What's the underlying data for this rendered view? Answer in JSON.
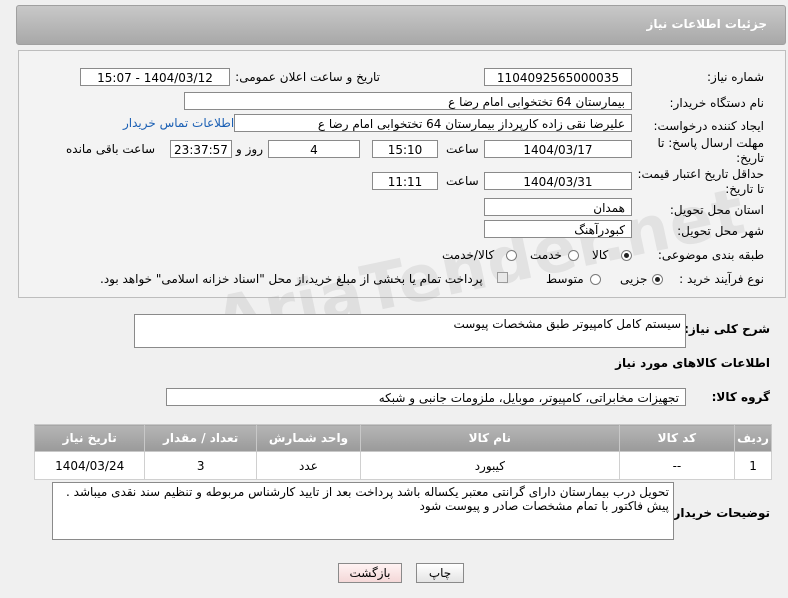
{
  "header": {
    "title": "جزئیات اطلاعات نیاز"
  },
  "form": {
    "need_number_label": "شماره نیاز:",
    "need_number": "1104092565000035",
    "announce_label": "تاریخ و ساعت اعلان عمومی:",
    "announce_value": "1404/03/12 - 15:07",
    "buyer_org_label": "نام دستگاه خریدار:",
    "buyer_org": "بیمارستان  64 تختخوابی امام رضا   ع",
    "creator_label": "ایجاد کننده درخواست:",
    "creator": "علیرضا نقی زاده کارپرداز بیمارستان  64 تختخوابی امام رضا   ع",
    "contact_link": "اطلاعات تماس خریدار",
    "reply_deadline_label_1": "مهلت ارسال پاسخ: تا",
    "reply_deadline_label_2": "تاریخ:",
    "reply_date": "1404/03/17",
    "time_label": "ساعت",
    "reply_time": "15:10",
    "days_value": "4",
    "days_label": "روز و",
    "remaining_time": "23:37:57",
    "remaining_label": "ساعت باقی مانده",
    "price_validity_label_1": "حداقل تاریخ اعتبار قیمت:",
    "price_validity_label_2": "تا تاریخ:",
    "price_date": "1404/03/31",
    "price_time": "11:11",
    "province_label": "استان محل تحویل:",
    "province": "همدان",
    "city_label": "شهر محل تحویل:",
    "city": "کبودرآهنگ",
    "category_label": "طبقه بندی موضوعی:",
    "category_options": [
      "کالا",
      "خدمت",
      "کالا/خدمت"
    ],
    "category_selected": "کالا",
    "process_label": "نوع فرآیند خرید :",
    "process_options": [
      "جزیی",
      "متوسط"
    ],
    "process_selected": "جزیی",
    "payment_note": "پرداخت تمام یا بخشی از مبلغ خرید،از محل \"اسناد خزانه اسلامی\" خواهد بود."
  },
  "description": {
    "label": "شرح کلی نیاز:",
    "value": "سیستم کامل کامپیوتر طبق مشخصات پیوست"
  },
  "goods": {
    "section_title": "اطلاعات کالاهای مورد نیاز",
    "group_label": "گروه کالا:",
    "group_value": "تجهیزات مخابراتی، کامپیوتر، موبایل، ملزومات جانبی و شبکه",
    "columns": [
      "ردیف",
      "کد کالا",
      "نام کالا",
      "واحد شمارش",
      "تعداد / مقدار",
      "تاریخ نیاز"
    ],
    "rows": [
      [
        "1",
        "--",
        "کیبورد",
        "عدد",
        "3",
        "1404/03/24"
      ]
    ]
  },
  "buyer_notes": {
    "label": "توضیحات خریدار:",
    "value": "تحویل درب بیمارستان دارای گرانتی معتبر یکساله باشد پرداخت بعد از تایید کارشناس مربوطه و تنظیم سند نقدی میباشد . پیش فاکتور با تمام مشخصات صادر و پیوست شود"
  },
  "buttons": {
    "print": "چاپ",
    "back": "بازگشت"
  },
  "watermark": "AriaTender.net"
}
